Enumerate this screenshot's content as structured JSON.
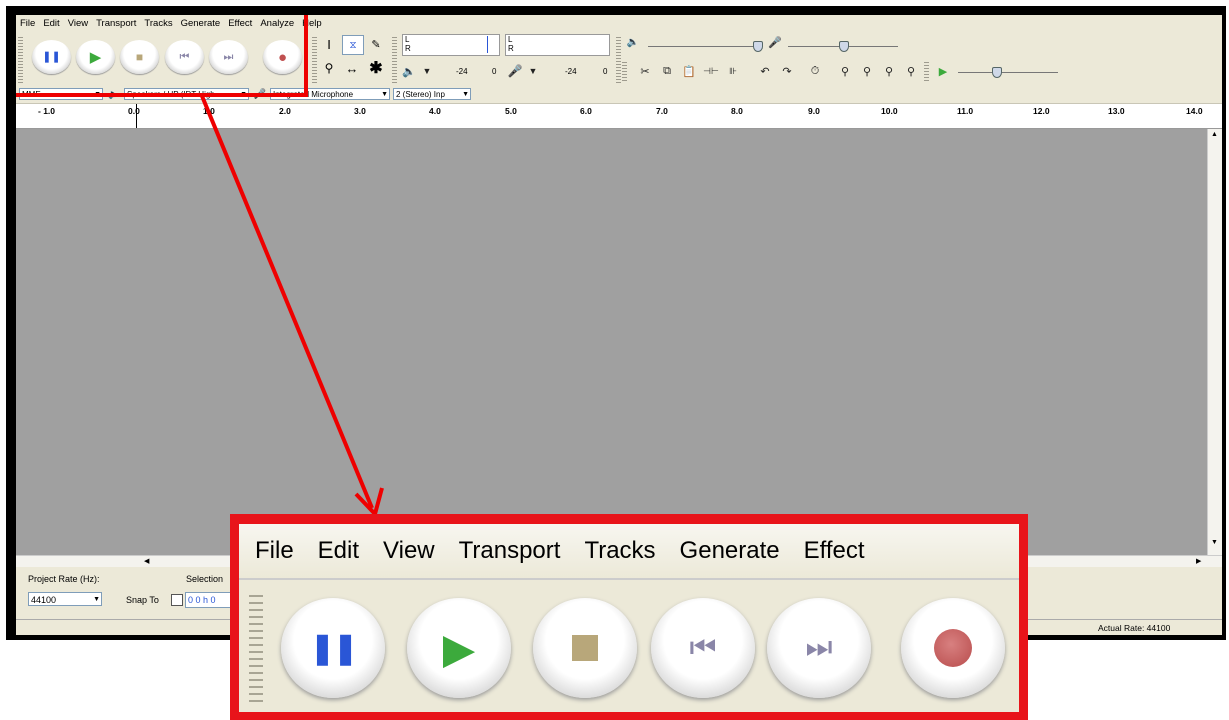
{
  "menu": [
    "File",
    "Edit",
    "View",
    "Transport",
    "Tracks",
    "Generate",
    "Effect",
    "Analyze",
    "Help"
  ],
  "transport_buttons": [
    {
      "name": "pause-button",
      "icon": "pause-icon",
      "glyph": "❚❚",
      "color": "#2a56d6"
    },
    {
      "name": "play-button",
      "icon": "play-icon",
      "glyph": "▶",
      "color": "#3caa3c"
    },
    {
      "name": "stop-button",
      "icon": "stop-icon",
      "glyph": "■",
      "color": "#b8a77a"
    },
    {
      "name": "skip-start-button",
      "icon": "skip-start-icon",
      "glyph": "⏮",
      "color": "#8a86a8"
    },
    {
      "name": "skip-end-button",
      "icon": "skip-end-icon",
      "glyph": "⏭",
      "color": "#8a86a8"
    },
    {
      "name": "record-button",
      "icon": "record-icon",
      "glyph": "●",
      "color": "#c05050"
    }
  ],
  "meters": {
    "left": "L",
    "right": "R",
    "playback_value": "-24",
    "playback_zero": "0",
    "record_value": "-24",
    "record_zero": "0"
  },
  "device": {
    "host": "MME",
    "output": "Speakers / HP (IDT High",
    "input": "Integrated Microphone",
    "channels": "2 (Stereo) Inp"
  },
  "ruler_ticks": [
    "- 1.0",
    "0.0",
    "1.0",
    "2.0",
    "3.0",
    "4.0",
    "5.0",
    "6.0",
    "7.0",
    "8.0",
    "9.0",
    "10.0",
    "11.0",
    "12.0",
    "13.0",
    "14.0"
  ],
  "selection_bar": {
    "project_rate_label": "Project Rate (Hz):",
    "project_rate_value": "44100",
    "selection_label": "Selection",
    "snap_to_label": "Snap To",
    "time_value": "0 0 h 0"
  },
  "status": {
    "actual_rate": "Actual Rate: 44100"
  },
  "colors": {
    "highlight": "#e00000",
    "accent_blue": "#2a56d6"
  }
}
